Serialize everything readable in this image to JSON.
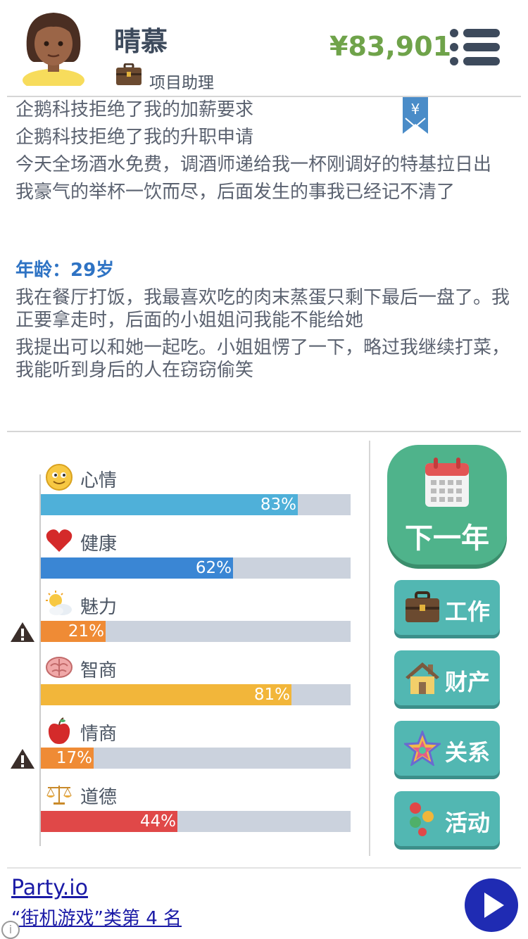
{
  "player": {
    "name": "晴慕",
    "job": "项目助理",
    "money": "¥83,901"
  },
  "log": {
    "lines_before": [
      "企鹅科技拒绝了我的加薪要求",
      "企鹅科技拒绝了我的升职申请",
      "今天全场酒水免费，调酒师递给我一杯刚调好的特基拉日出",
      "我豪气的举杯一饮而尽，后面发生的事我已经记不清了"
    ],
    "age_label": "年龄：29岁",
    "lines_after": [
      "我在餐厅打饭，我最喜欢吃的肉末蒸蛋只剩下最后一盘了。我正要拿走时，后面的小姐姐问我能不能给她",
      "我提出可以和她一起吃。小姐姐愣了一下，略过我继续打菜，我能听到身后的人在窃窃偷笑"
    ]
  },
  "stats": [
    {
      "label": "心情",
      "value": 83,
      "value_text": "83%",
      "color": "#4fb0d9",
      "warning": false,
      "icon": "smiley-icon"
    },
    {
      "label": "健康",
      "value": 62,
      "value_text": "62%",
      "color": "#3a86d4",
      "warning": false,
      "icon": "heart-icon"
    },
    {
      "label": "魅力",
      "value": 21,
      "value_text": "21%",
      "color": "#ef8b35",
      "warning": true,
      "icon": "sun-cloud-icon"
    },
    {
      "label": "智商",
      "value": 81,
      "value_text": "81%",
      "color": "#f2b63a",
      "warning": false,
      "icon": "brain-icon"
    },
    {
      "label": "情商",
      "value": 17,
      "value_text": "17%",
      "color": "#ef8b35",
      "warning": true,
      "icon": "apple-icon"
    },
    {
      "label": "道德",
      "value": 44,
      "value_text": "44%",
      "color": "#e04848",
      "warning": false,
      "icon": "scales-icon"
    }
  ],
  "actions": {
    "next_year": "下一年",
    "work": "工作",
    "property": "财产",
    "relations": "关系",
    "activities": "活动"
  },
  "ad": {
    "title": "Party.io",
    "subtitle": "“街机游戏”类第 4 名"
  }
}
